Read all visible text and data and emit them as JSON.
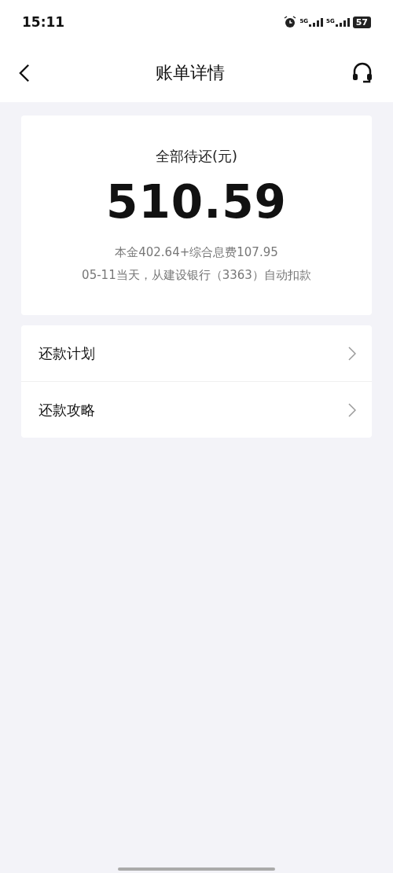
{
  "status_bar": {
    "time": "15:11",
    "networks": [
      "5G",
      "5G"
    ],
    "battery": "57"
  },
  "header": {
    "title": "账单详情"
  },
  "summary": {
    "label": "全部待还(元)",
    "amount": "510.59",
    "breakdown": "本金402.64+综合息费107.95",
    "note": "05-11当天，从建设银行（3363）自动扣款"
  },
  "menu": [
    {
      "label": "还款计划"
    },
    {
      "label": "还款攻略"
    }
  ]
}
